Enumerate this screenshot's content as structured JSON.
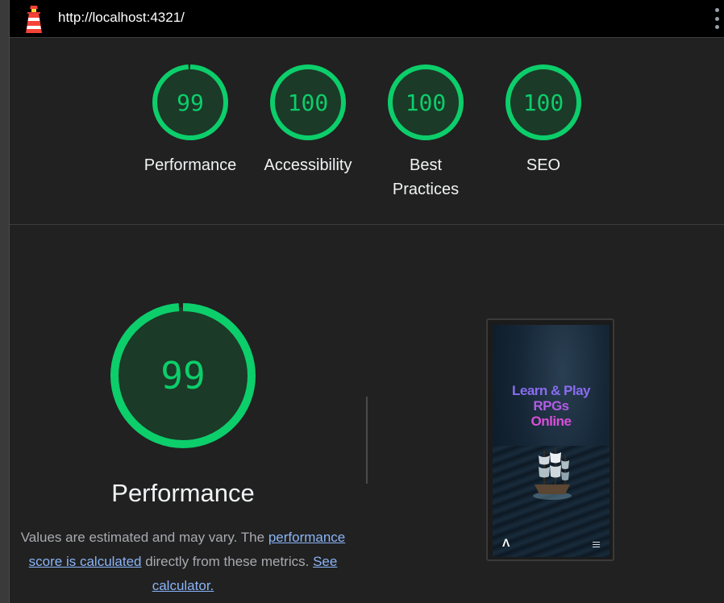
{
  "topbar": {
    "url": "http://localhost:4321/"
  },
  "scores": [
    {
      "label": "Performance",
      "score": "99"
    },
    {
      "label": "Accessibility",
      "score": "100"
    },
    {
      "label": "Best Practices",
      "score": "100"
    },
    {
      "label": "SEO",
      "score": "100"
    }
  ],
  "performance": {
    "score": "99",
    "title": "Performance",
    "desc_part1": "Values are estimated and may vary. The ",
    "desc_link1": "performance score is calculated",
    "desc_part2": " directly from these metrics. ",
    "desc_link2": "See calculator."
  },
  "screenshot": {
    "hero_line1": "Learn & Play",
    "hero_line2": "RPGs",
    "hero_line3": "Online"
  },
  "colors": {
    "pass_green": "#0cce6b",
    "gauge_fill": "#1b3a27",
    "link": "#8ab4f8"
  },
  "icons": {
    "logo": "lighthouse-logo",
    "menu": "vertical-dots-icon",
    "site_logo": "astro-logo-icon",
    "site_menu": "hamburger-icon"
  }
}
